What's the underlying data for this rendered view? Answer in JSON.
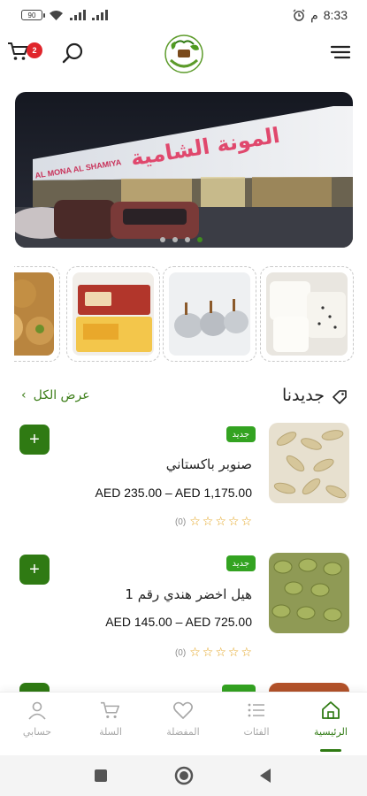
{
  "status_bar": {
    "battery": "90",
    "time": "8:33",
    "ampm": "م"
  },
  "header": {
    "cart_count": "2",
    "logo_text": "Al Mouna Al Shamiya"
  },
  "banner": {
    "sign_arabic": "المونة الشامية",
    "sign_latin": "AL MONA AL SHAMIYA",
    "slide_count": 4,
    "active_slide": 4
  },
  "section": {
    "title": "جديدنا",
    "view_all": "عرض الكل"
  },
  "products": [
    {
      "badge": "جديد",
      "name": "صنوبر باكستاني",
      "price": "AED 235.00 – AED 1,175.00",
      "rating_count": "(0)",
      "stars": 0
    },
    {
      "badge": "جديد",
      "name": "هيل اخضر هندي رقم 1",
      "price": "AED 145.00 – AED 725.00",
      "rating_count": "(0)",
      "stars": 0
    }
  ],
  "bottom_nav": {
    "home": "الرئيسية",
    "categories": "الفئات",
    "favorites": "المفضلة",
    "cart": "السلة",
    "account": "حسابي",
    "active": "home"
  },
  "colors": {
    "primary": "#2f7a13",
    "badge_green": "#33a321",
    "cart_badge": "#e0252b",
    "star": "#e3a21a"
  }
}
